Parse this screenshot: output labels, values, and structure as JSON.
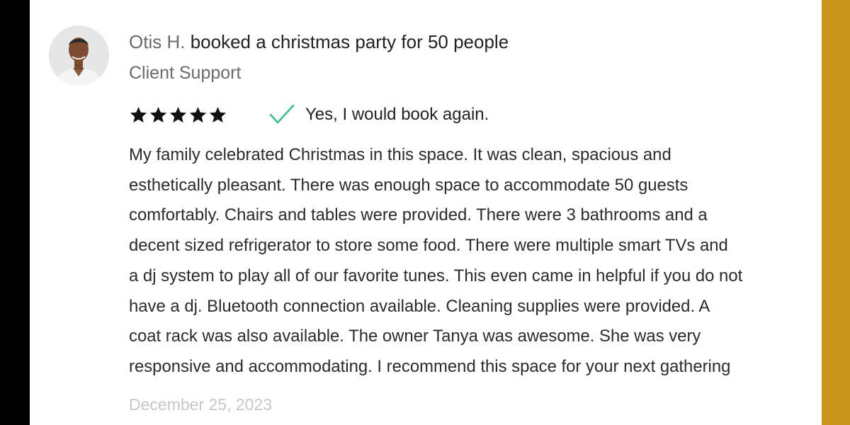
{
  "review": {
    "reviewer_name": "Otis H.",
    "event_summary": "booked a christmas party for 50 people",
    "reviewer_role": "Client Support",
    "rating_stars": 5,
    "would_book_again": "Yes, I would book again.",
    "body_lines": [
      "My family celebrated Christmas in this space. It was clean, spacious and",
      "esthetically pleasant. There was enough space to accommodate 50 guests",
      "comfortably. Chairs and tables were provided. There were 3 bathrooms and a",
      "decent sized refrigerator to store some food. There were multiple smart TVs and",
      "a dj system to play all of our favorite tunes. This even came in helpful if you do not",
      "have a dj. Bluetooth connection available. Cleaning supplies were provided. A",
      "coat rack was also available. The owner Tanya was awesome. She was very",
      "responsive and accommodating. I recommend this space for your next gathering"
    ],
    "date": "December 25, 2023"
  },
  "icons": {
    "star": "star-icon",
    "check": "check-icon"
  },
  "colors": {
    "star": "#111111",
    "check": "#3dbd8a",
    "right_accent": "#c8941b",
    "name_gray": "#6b6b6b",
    "date_gray": "#c7c7c7"
  }
}
